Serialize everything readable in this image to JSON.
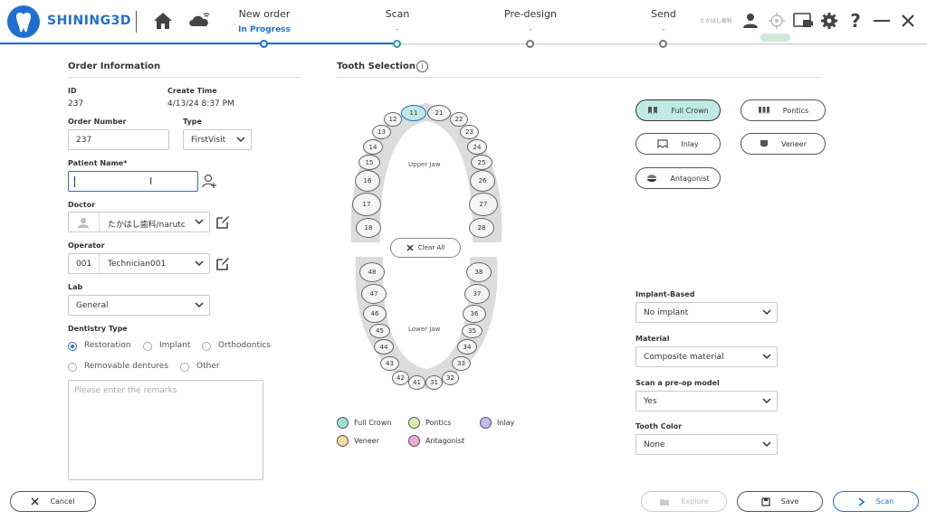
{
  "header": {
    "brand": "SHINING3D",
    "user_label": "たかはし歯科",
    "steps": [
      {
        "title": "New order",
        "status": "In Progress"
      },
      {
        "title": "Scan",
        "status": "-"
      },
      {
        "title": "Pre-design",
        "status": "-"
      },
      {
        "title": "Send",
        "status": "-"
      }
    ],
    "colors": {
      "accent": "#1f6fd1",
      "teal": "#2a9d8f"
    }
  },
  "order": {
    "section_title": "Order Information",
    "id_label": "ID",
    "id_value": "237",
    "create_time_label": "Create Time",
    "create_time_value": "4/13/24 8:37 PM",
    "order_number_label": "Order Number",
    "order_number_value": "237",
    "type_label": "Type",
    "type_value": "FirstVisit",
    "patient_name_label": "Patient Name*",
    "patient_name_value": "",
    "doctor_label": "Doctor",
    "doctor_value": "たかはし歯科/narutc",
    "operator_label": "Operator",
    "operator_code": "001",
    "operator_value": "Technician001",
    "lab_label": "Lab",
    "lab_value": "General",
    "dentistry_type_label": "Dentistry Type",
    "dentistry_options": [
      "Restoration",
      "Implant",
      "Orthodontics",
      "Removable dentures",
      "Other"
    ],
    "dentistry_selected": "Restoration",
    "remarks_placeholder": "Please enter the remarks"
  },
  "tooth": {
    "section_title": "Tooth Selection",
    "upper_label": "Upper Jaw",
    "lower_label": "Lower Jaw",
    "clear_all": "Clear All",
    "selected": [
      "11"
    ],
    "types": [
      "Full Crown",
      "Pontics",
      "Inlay",
      "Veneer",
      "Antagonist"
    ],
    "active_type": "Full Crown",
    "legend": [
      {
        "label": "Full Crown",
        "color": "#9fe0d4"
      },
      {
        "label": "Pontics",
        "color": "#d8efb4"
      },
      {
        "label": "Inlay",
        "color": "#c5b8ef"
      },
      {
        "label": "Veneer",
        "color": "#f2dca0"
      },
      {
        "label": "Antagonist",
        "color": "#efa9d9"
      }
    ],
    "implant_based_label": "Implant-Based",
    "implant_based_value": "No implant",
    "material_label": "Material",
    "material_value": "Composite material",
    "preop_label": "Scan a pre-op model",
    "preop_value": "Yes",
    "tooth_color_label": "Tooth Color",
    "tooth_color_value": "None"
  },
  "footer": {
    "cancel": "Cancel",
    "explore": "Explore",
    "save": "Save",
    "scan": "Scan"
  }
}
